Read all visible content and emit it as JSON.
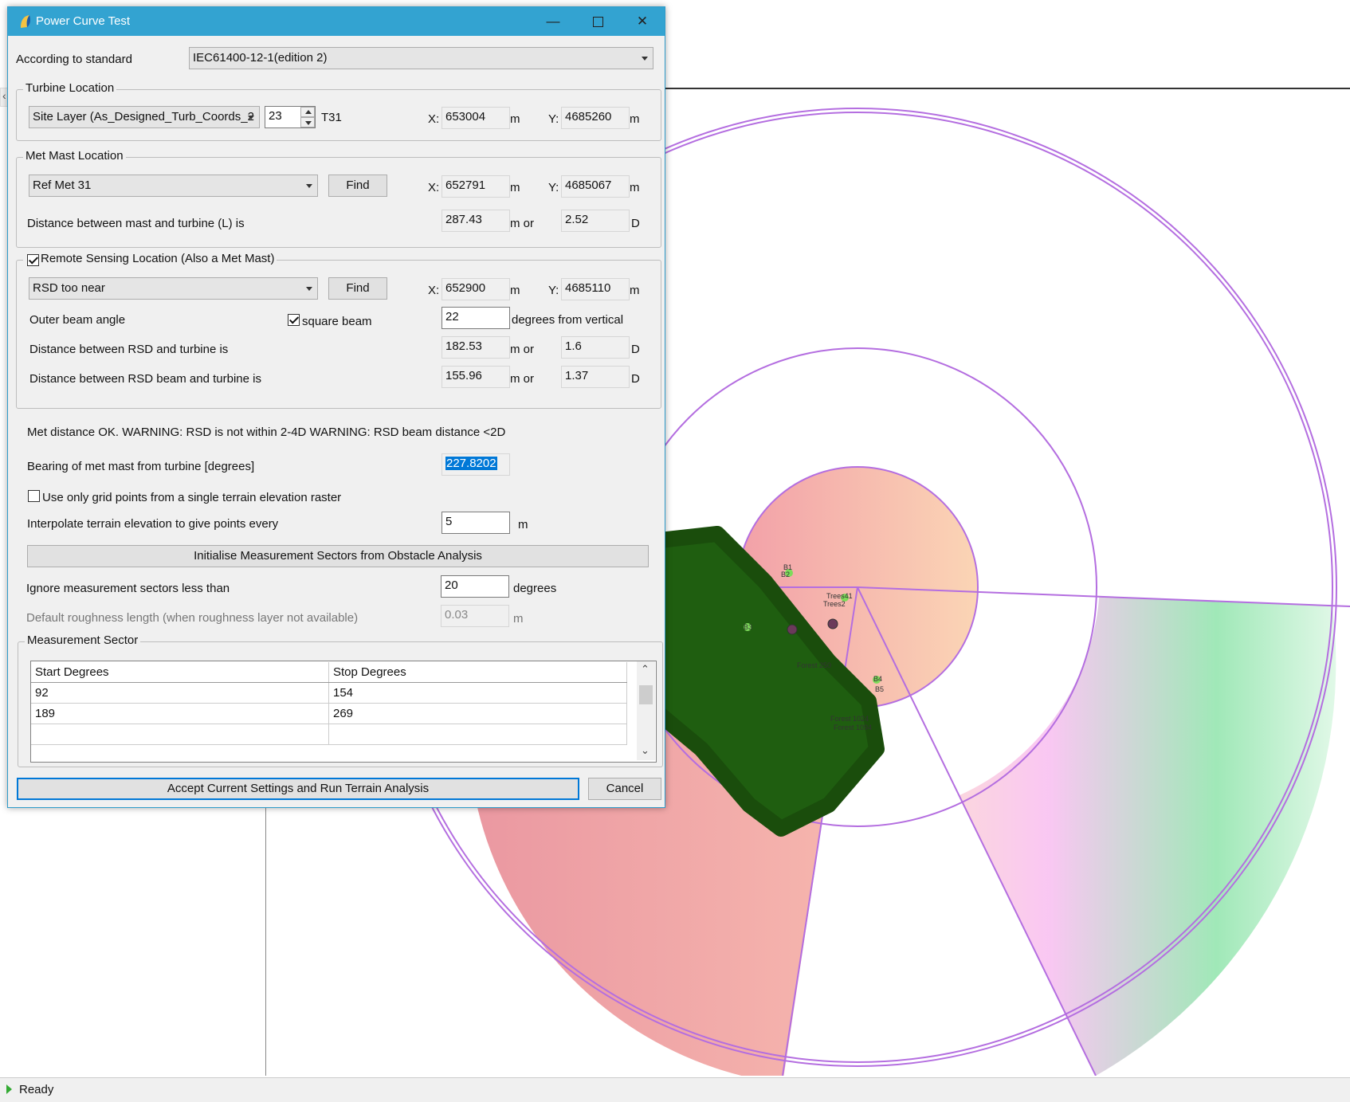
{
  "dialog": {
    "title": "Power Curve Test",
    "standard_label": "According to standard",
    "standard_value": "IEC61400-12-1(edition 2)",
    "turbine": {
      "legend": "Turbine Location",
      "layer": "Site Layer (As_Designed_Turb_Coords_2",
      "index": "23",
      "name": "T31",
      "x_label": "X:",
      "x": "653004",
      "y_label": "Y:",
      "y": "4685260",
      "unit": "m"
    },
    "met_mast": {
      "legend": "Met Mast Location",
      "selection": "Ref Met 31",
      "find_label": "Find",
      "x_label": "X:",
      "x": "652791",
      "y_label": "Y:",
      "y": "4685067",
      "unit": "m",
      "distance_label": "Distance between mast and turbine (L) is",
      "distance_m": "287.43",
      "m_or": "m or",
      "distance_d": "2.52",
      "d_unit": "D"
    },
    "remote_sensing": {
      "legend": "Remote Sensing Location (Also a Met Mast)",
      "checked": true,
      "selection": "RSD too near",
      "find_label": "Find",
      "x_label": "X:",
      "x": "652900",
      "y_label": "Y:",
      "y": "4685110",
      "unit": "m",
      "beam_angle_label": "Outer beam angle",
      "square_beam_label": "square beam",
      "square_beam_checked": true,
      "beam_angle": "22",
      "beam_unit": "degrees from vertical",
      "rsd_distance_label": "Distance between RSD and turbine is",
      "rsd_distance_m": "182.53",
      "m_or": "m or",
      "rsd_distance_d": "1.6",
      "d_unit": "D",
      "beam_distance_label": "Distance between RSD beam and turbine is",
      "beam_distance_m": "155.96",
      "beam_distance_d": "1.37"
    },
    "warning": "Met distance OK. WARNING: RSD is not within 2-4D WARNING: RSD beam distance <2D",
    "bearing_label": "Bearing of met mast from turbine [degrees]",
    "bearing": "227.8202",
    "single_raster_label": "Use only grid points from a single terrain elevation raster",
    "single_raster_checked": false,
    "interpolate_label": "Interpolate terrain elevation to give points every",
    "interpolate_value": "5",
    "interpolate_unit": "m",
    "init_sectors_label": "Initialise Measurement Sectors from Obstacle Analysis",
    "ignore_label": "Ignore measurement sectors less than",
    "ignore_value": "20",
    "ignore_unit": "degrees",
    "roughness_label": "Default roughness length (when roughness layer not available)",
    "roughness_value": "0.03",
    "roughness_unit": "m",
    "sector": {
      "legend": "Measurement Sector",
      "headers": [
        "Start Degrees",
        "Stop Degrees"
      ],
      "rows": [
        [
          "92",
          "154"
        ],
        [
          "189",
          "269"
        ],
        [
          "",
          ""
        ]
      ]
    },
    "accept_label": "Accept Current Settings and Run Terrain Analysis",
    "cancel_label": "Cancel"
  },
  "map": {
    "labels": [
      "B1",
      "B2",
      "Trees41",
      "Trees2",
      "B3",
      "B4",
      "B5",
      "Forest 250",
      "Forest 1024",
      "Forest 1094"
    ]
  },
  "status": {
    "text": "Ready"
  },
  "colors": {
    "title_bar": "#33a3d1",
    "ring": "#b46ee0",
    "forest": "#1f5e10",
    "accent": "#0078d7"
  }
}
